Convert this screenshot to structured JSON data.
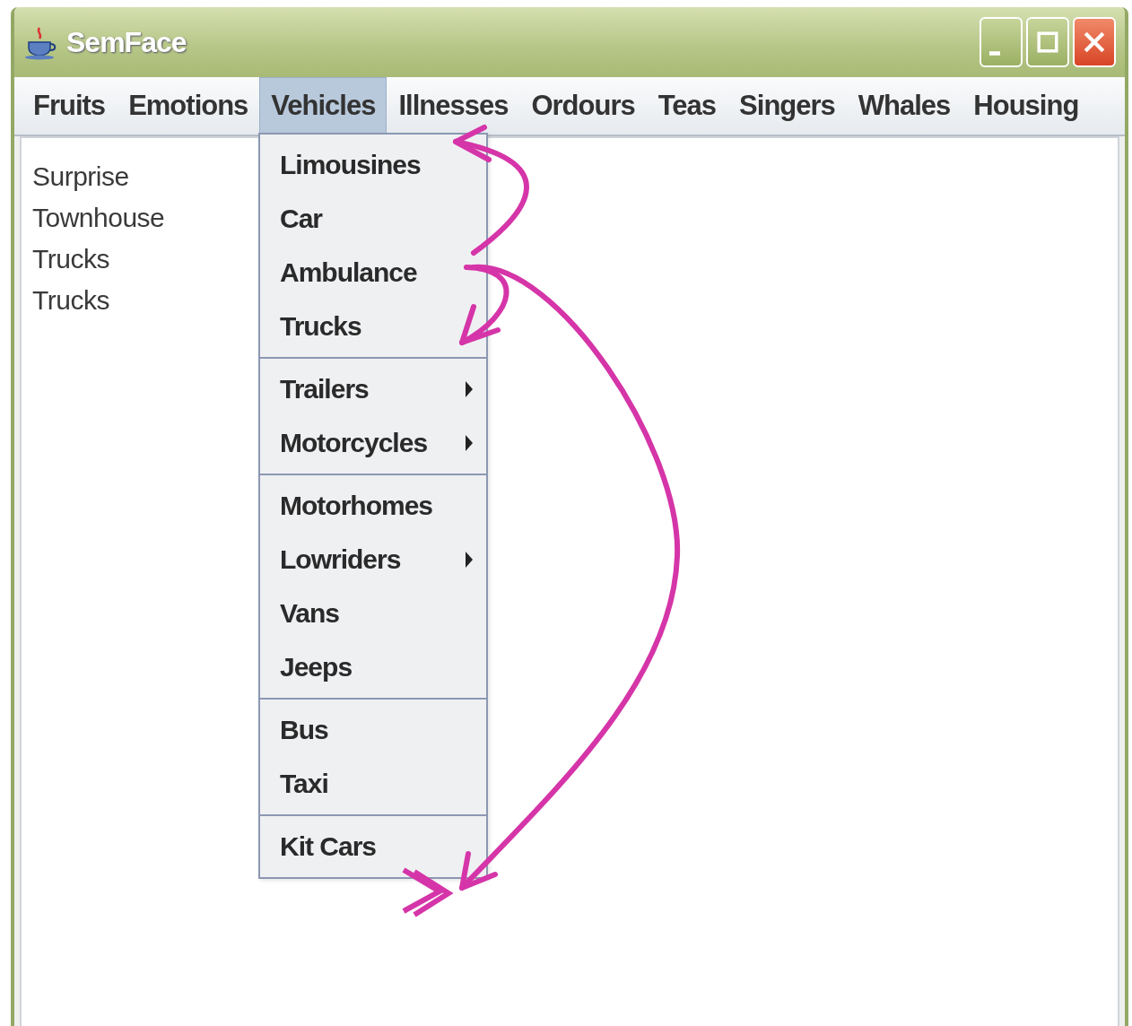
{
  "window": {
    "title": "SemFace"
  },
  "menu_bar": [
    {
      "label": "Fruits",
      "selected": false
    },
    {
      "label": "Emotions",
      "selected": false
    },
    {
      "label": "Vehicles",
      "selected": true
    },
    {
      "label": "Illnesses",
      "selected": false
    },
    {
      "label": "Ordours",
      "selected": false
    },
    {
      "label": "Teas",
      "selected": false
    },
    {
      "label": "Singers",
      "selected": false
    },
    {
      "label": "Whales",
      "selected": false
    },
    {
      "label": "Housing",
      "selected": false
    }
  ],
  "list_items": [
    "Surprise",
    "Townhouse",
    "Trucks",
    "Trucks"
  ],
  "dropdown_menu": {
    "groups": [
      [
        {
          "label": "Limousines",
          "kind": "item"
        },
        {
          "label": "Car",
          "kind": "item"
        },
        {
          "label": "Ambulance",
          "kind": "item"
        },
        {
          "label": "Trucks",
          "kind": "item"
        }
      ],
      [
        {
          "label": "Trailers",
          "kind": "submenu"
        },
        {
          "label": "Motorcycles",
          "kind": "submenu"
        }
      ],
      [
        {
          "label": "Motorhomes",
          "kind": "item"
        },
        {
          "label": "Lowriders",
          "kind": "submenu"
        },
        {
          "label": "Vans",
          "kind": "item"
        },
        {
          "label": "Jeeps",
          "kind": "item"
        }
      ],
      [
        {
          "label": "Bus",
          "kind": "item"
        },
        {
          "label": "Taxi",
          "kind": "item"
        }
      ],
      [
        {
          "label": "Kit Cars",
          "kind": "item"
        }
      ]
    ]
  }
}
